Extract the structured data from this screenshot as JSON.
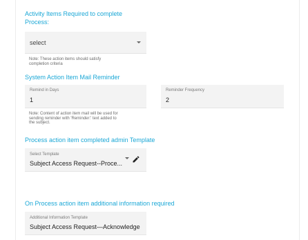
{
  "activity": {
    "heading_line1": "Activity Items Required to complete",
    "heading_line2": "Process:",
    "select_value": "select",
    "note_line1": "Note: These action items should satisfy",
    "note_line2": "completion criteria"
  },
  "mail_reminder": {
    "heading": "System Action Item Mail Reminder",
    "remind_in_days_label": "Remind in Days",
    "remind_in_days_value": "1",
    "reminder_frequency_label": "Reminder Frequency",
    "reminder_frequency_value": "2",
    "note_line1": "Note: Content of action item mail will be used for",
    "note_line2": "sending reminder with 'Reminder:' text added to",
    "note_line3": "the subject."
  },
  "admin_template": {
    "heading": "Process action item completed admin Template",
    "select_label": "Select Template",
    "select_value": "Subject Access Request--Proce..."
  },
  "additional_info": {
    "heading": "On Process action item additional information required",
    "template_label": "Additional Information Template",
    "template_value": "Subject Access Request—Acknowledge"
  },
  "colors": {
    "accent": "#1aa7d6",
    "field_bg": "#f3f3f3"
  },
  "icons": {
    "dropdown": "chevron-down-icon",
    "edit": "pencil-icon"
  }
}
